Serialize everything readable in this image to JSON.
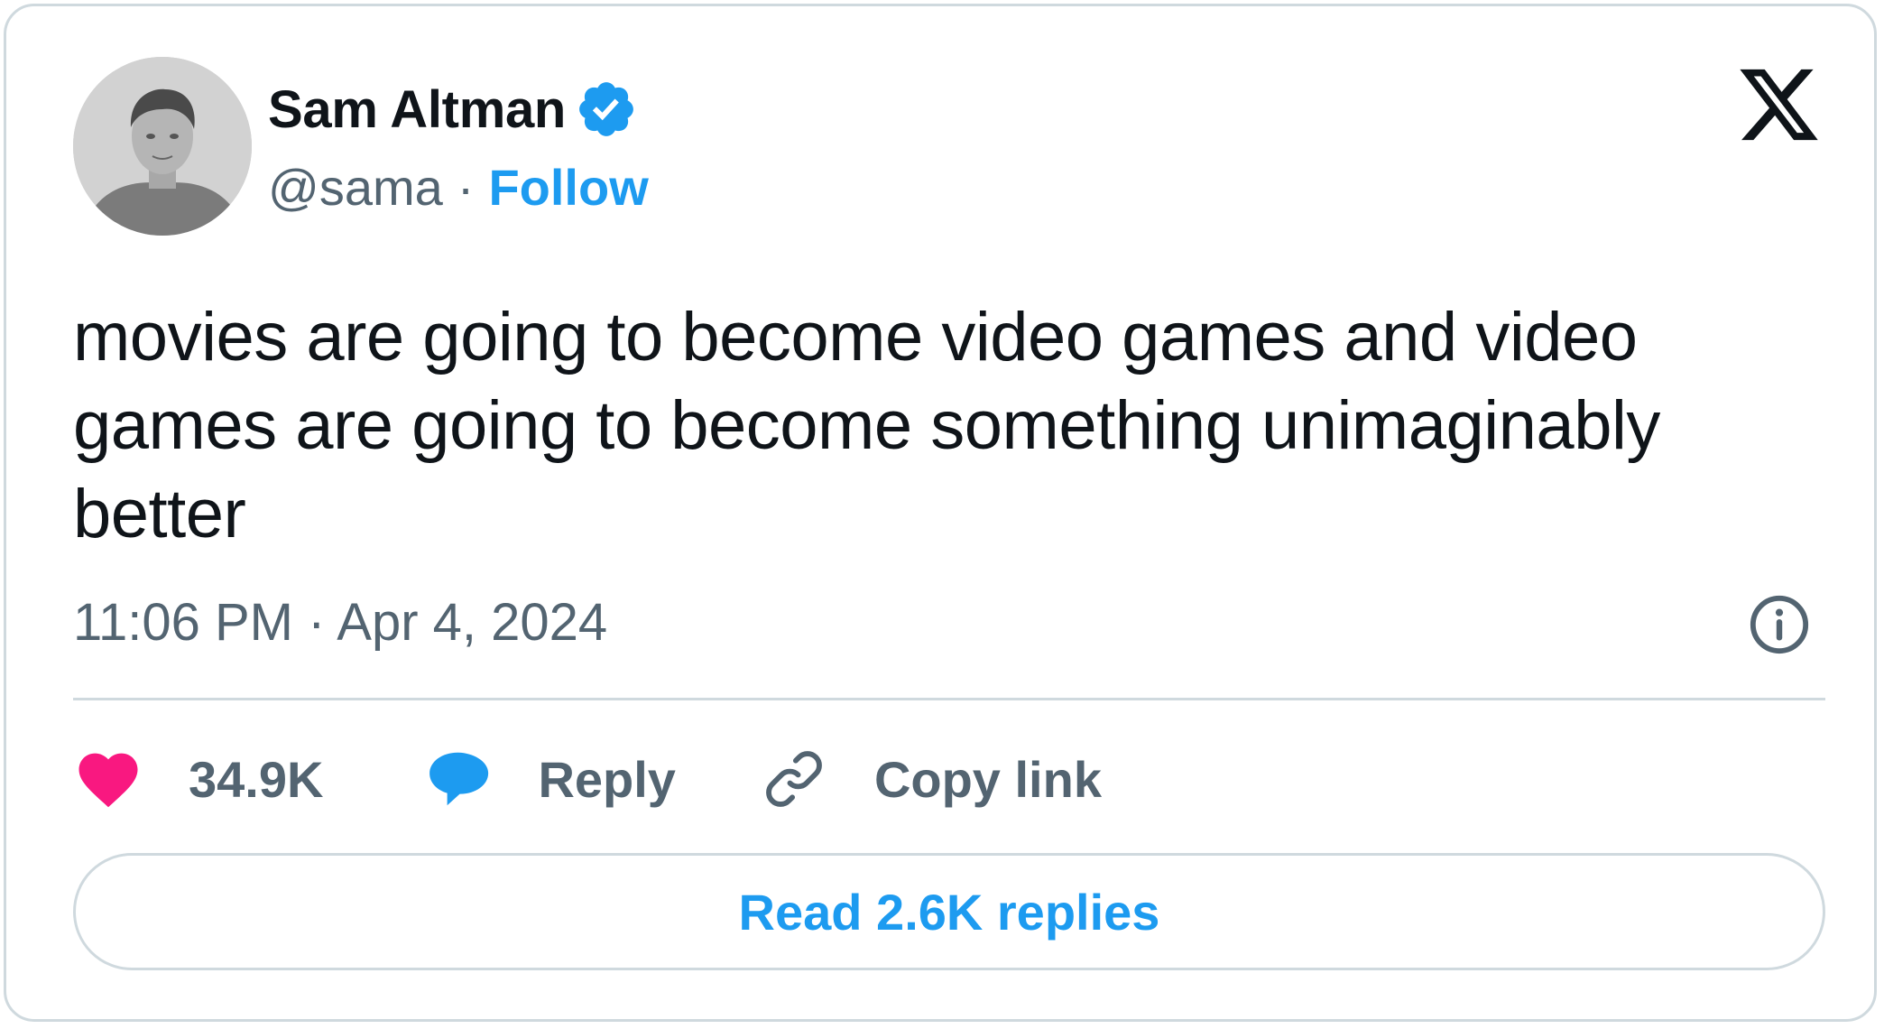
{
  "author": {
    "display_name": "Sam Altman",
    "handle": "@sama",
    "separator": "·",
    "follow_label": "Follow",
    "verified": true,
    "verified_icon": "verified-badge-icon"
  },
  "platform_logo": "x-logo-icon",
  "tweet": {
    "text": "movies are going to become video games and video games are going to become something unimaginably better",
    "timestamp": "11:06 PM · Apr 4, 2024"
  },
  "actions": {
    "like_count": "34.9K",
    "reply_label": "Reply",
    "copy_link_label": "Copy link"
  },
  "footer": {
    "read_replies_label": "Read 2.6K replies"
  },
  "colors": {
    "text_primary": "#0f1419",
    "text_secondary": "#536471",
    "accent_blue": "#1d9bf0",
    "like_pink": "#f91880",
    "border": "#cfd9de"
  }
}
